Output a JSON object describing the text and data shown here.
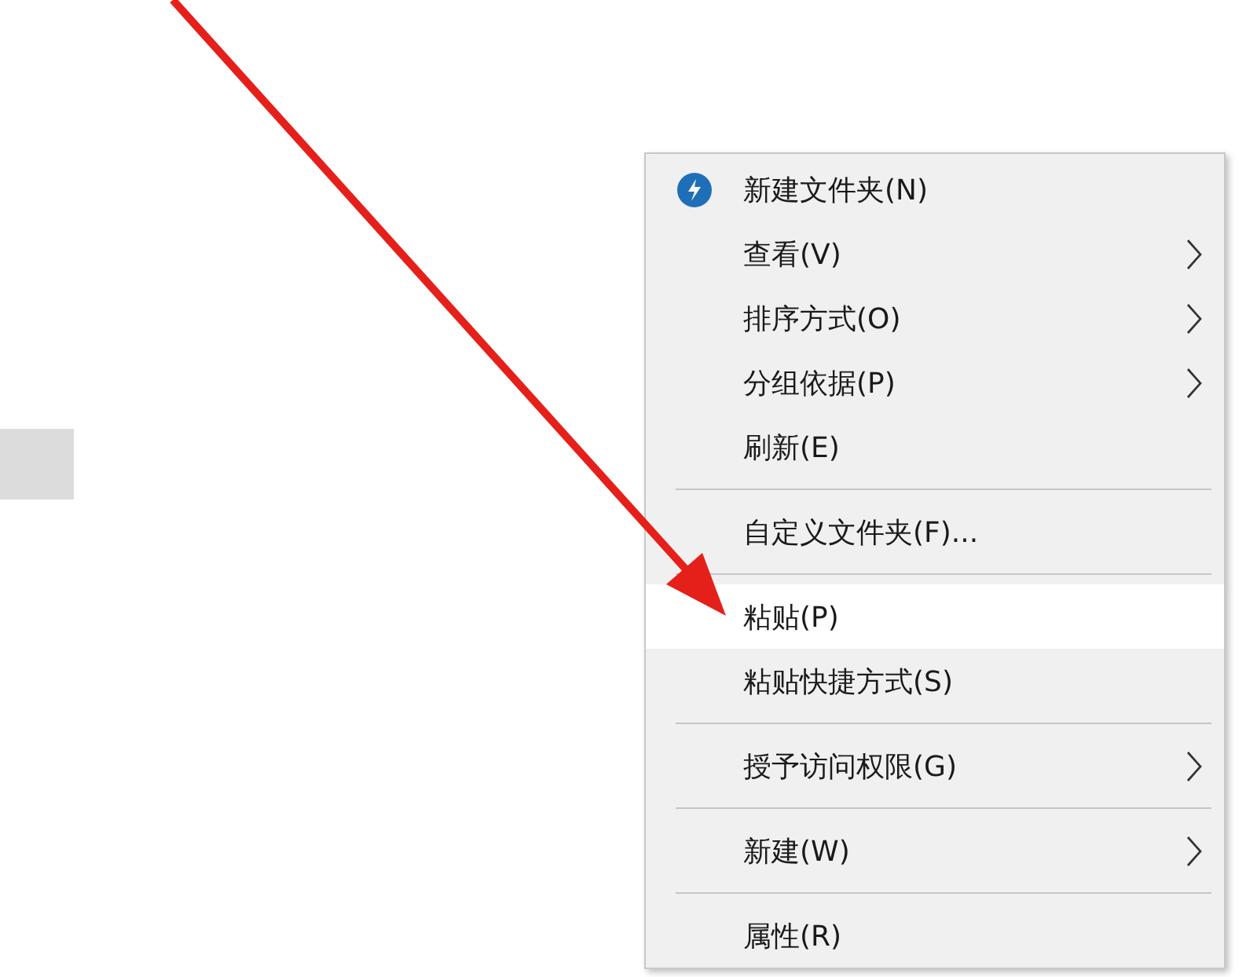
{
  "context_menu": {
    "items": [
      {
        "kind": "icon_item",
        "label": "新建文件夹(N)",
        "submenu": false,
        "selected": false
      },
      {
        "kind": "item",
        "label": "查看(V)",
        "submenu": true,
        "selected": false
      },
      {
        "kind": "item",
        "label": "排序方式(O)",
        "submenu": true,
        "selected": false
      },
      {
        "kind": "item",
        "label": "分组依据(P)",
        "submenu": true,
        "selected": false
      },
      {
        "kind": "item",
        "label": "刷新(E)",
        "submenu": false,
        "selected": false
      },
      {
        "kind": "separator"
      },
      {
        "kind": "item",
        "label": "自定义文件夹(F)...",
        "submenu": false,
        "selected": false
      },
      {
        "kind": "separator"
      },
      {
        "kind": "item",
        "label": "粘贴(P)",
        "submenu": false,
        "selected": true
      },
      {
        "kind": "item",
        "label": "粘贴快捷方式(S)",
        "submenu": false,
        "selected": false
      },
      {
        "kind": "separator"
      },
      {
        "kind": "item",
        "label": "授予访问权限(G)",
        "submenu": true,
        "selected": false
      },
      {
        "kind": "separator"
      },
      {
        "kind": "item",
        "label": "新建(W)",
        "submenu": true,
        "selected": false
      },
      {
        "kind": "separator"
      },
      {
        "kind": "item",
        "label": "属性(R)",
        "submenu": false,
        "selected": false
      }
    ]
  }
}
